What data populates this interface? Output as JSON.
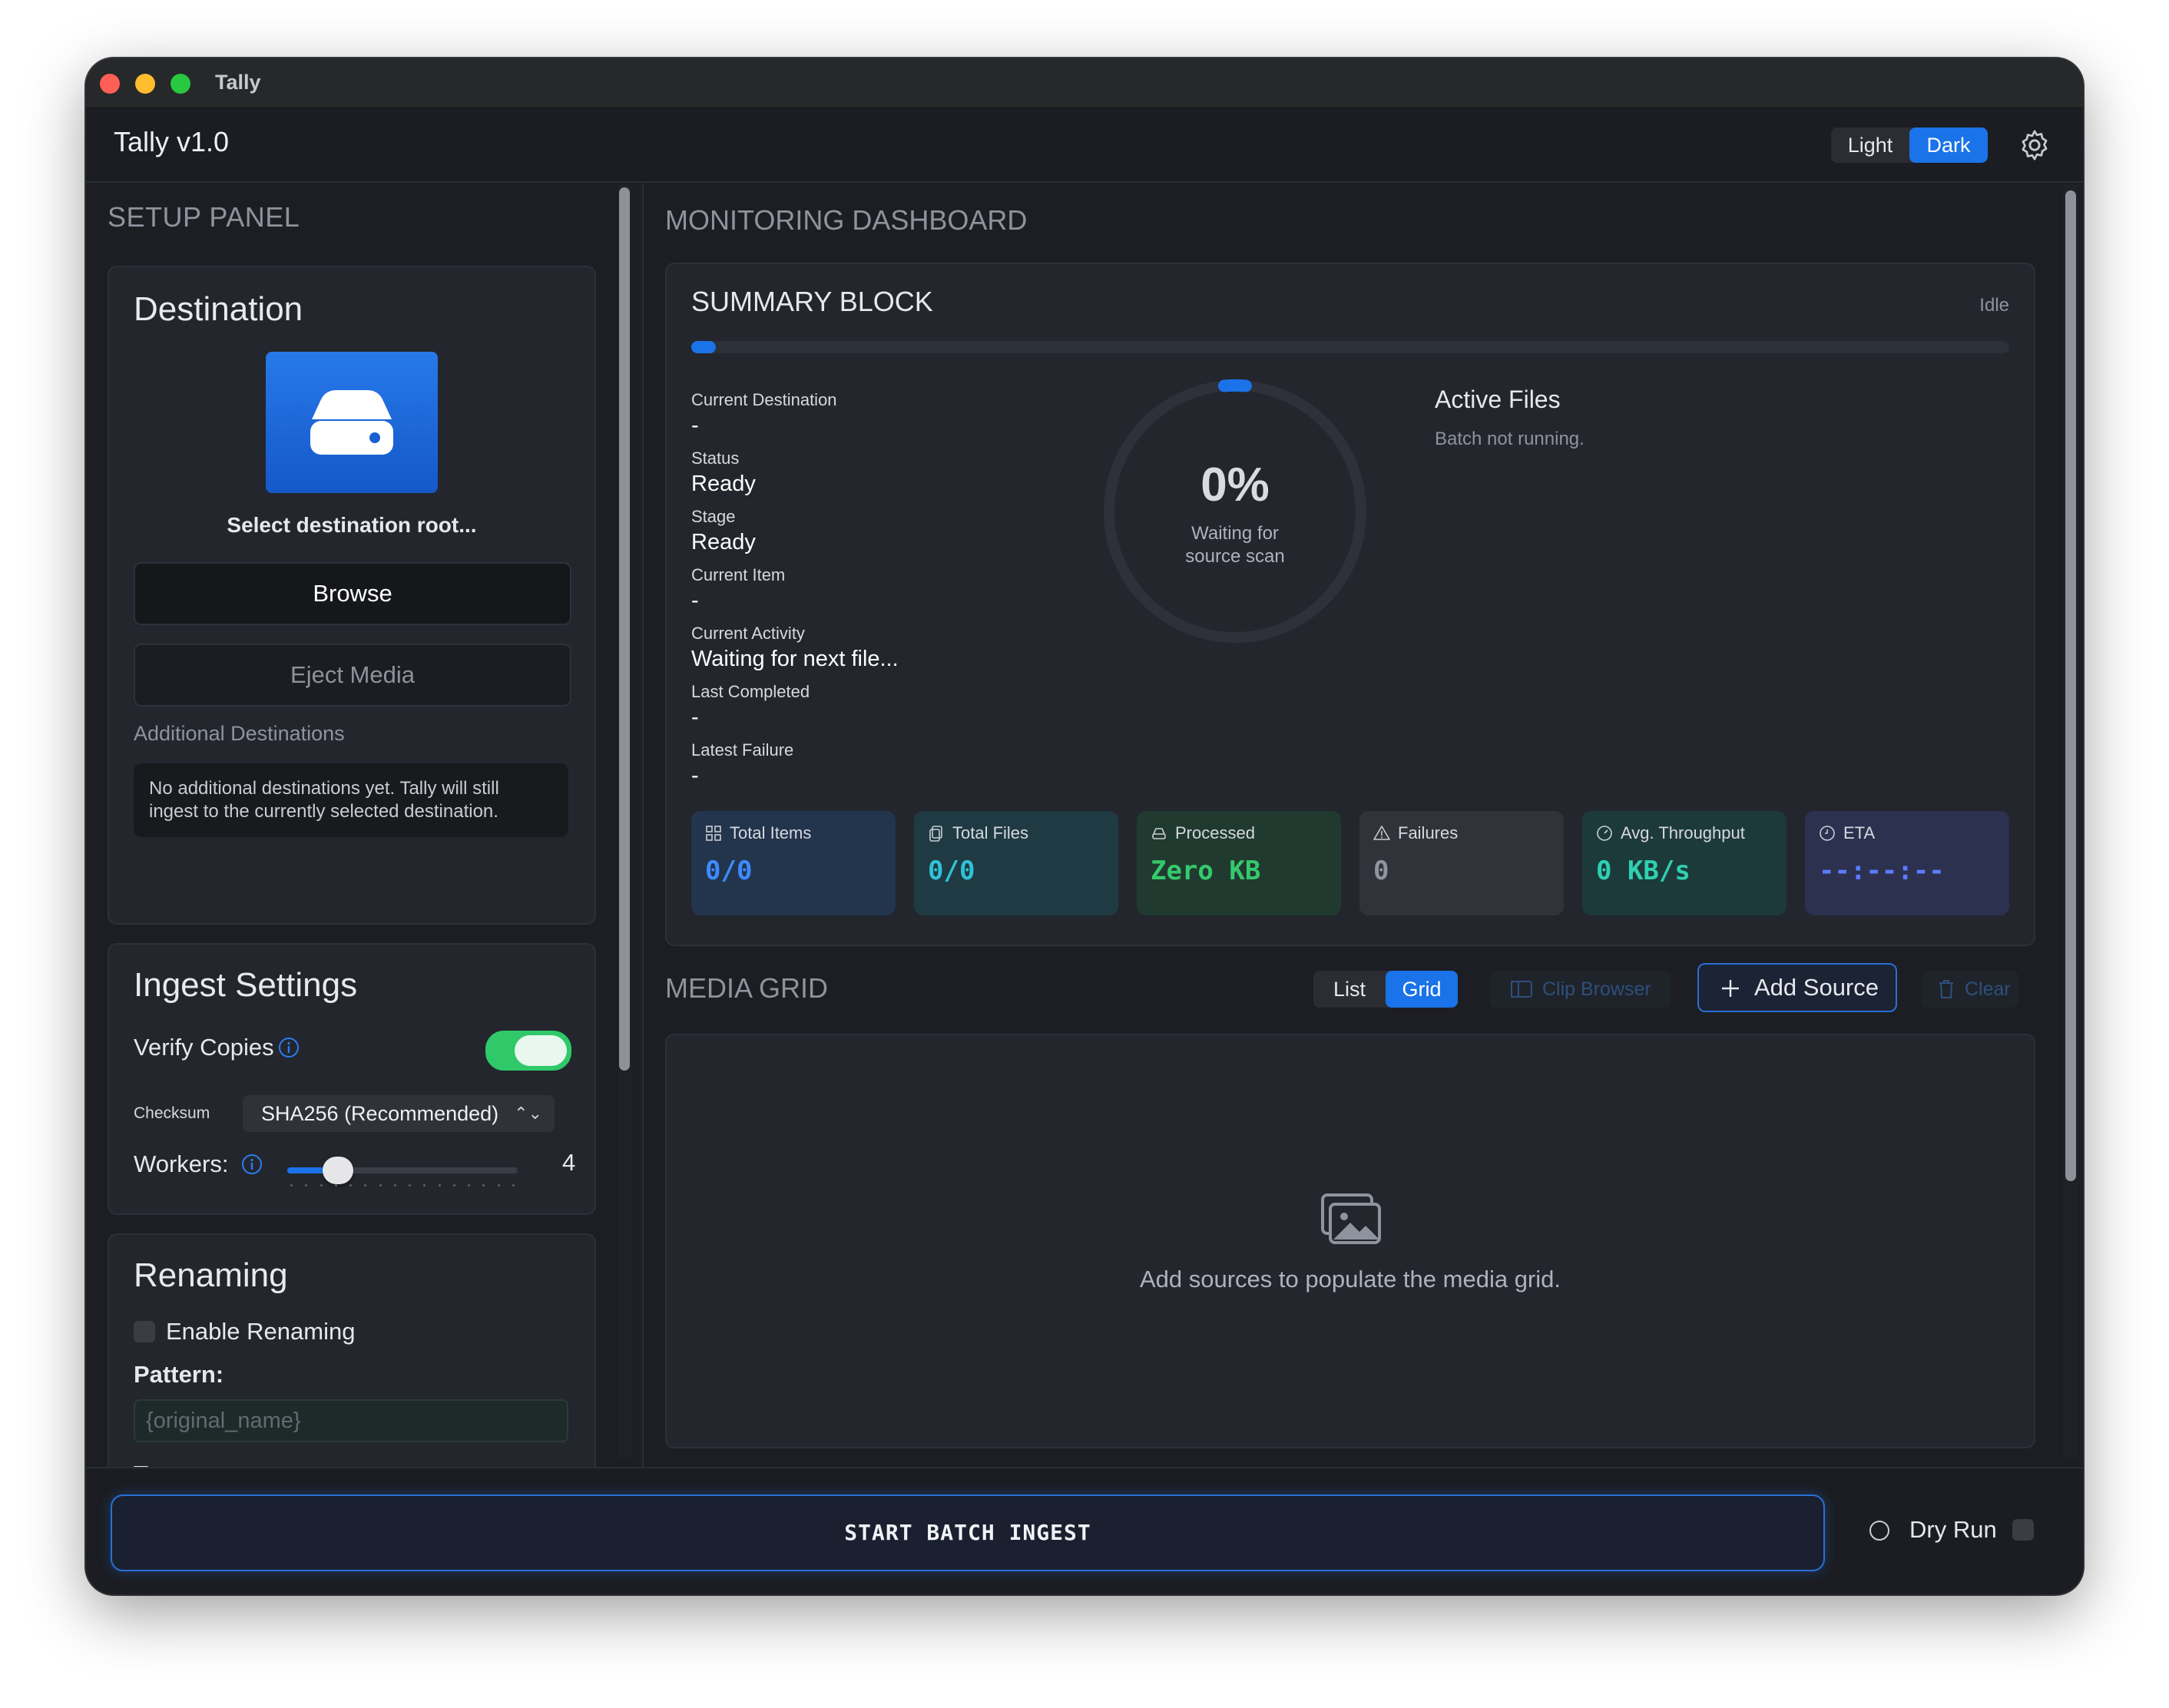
{
  "window": {
    "title": "Tally"
  },
  "header": {
    "app_title": "Tally v1.0",
    "theme_options": [
      "Light",
      "Dark"
    ],
    "theme_selected": "Dark",
    "settings_icon": "gear-icon"
  },
  "setup": {
    "section_title": "SETUP PANEL",
    "destination": {
      "title": "Destination",
      "icon": "drive-icon",
      "select_label": "Select destination root...",
      "browse_label": "Browse",
      "eject_label": "Eject Media",
      "additional_label": "Additional Destinations",
      "additional_note": "No additional destinations yet. Tally will still ingest to the currently selected destination."
    },
    "ingest": {
      "title": "Ingest Settings",
      "verify_label": "Verify Copies",
      "verify_enabled": true,
      "checksum_label": "Checksum",
      "checksum_value": "SHA256 (Recommended)",
      "workers_label": "Workers:",
      "workers_value": "4",
      "workers_fraction": 0.22
    },
    "renaming": {
      "title": "Renaming",
      "enable_label": "Enable Renaming",
      "enabled": false,
      "pattern_label": "Pattern:",
      "pattern_placeholder": "{original_name}",
      "tags_label": "Tags:"
    }
  },
  "dashboard": {
    "section_title": "MONITORING DASHBOARD",
    "summary": {
      "title": "SUMMARY BLOCK",
      "state": "Idle",
      "progress": 0,
      "fields": [
        {
          "k": "Current Destination",
          "v": "-"
        },
        {
          "k": "Status",
          "v": "Ready"
        },
        {
          "k": "Stage",
          "v": "Ready"
        },
        {
          "k": "Current Item",
          "v": "-"
        },
        {
          "k": "Current Activity",
          "v": "Waiting for next file..."
        },
        {
          "k": "Last Completed",
          "v": "-"
        },
        {
          "k": "Latest Failure",
          "v": "-"
        }
      ],
      "ring_percent": "0%",
      "ring_caption": "Waiting for source scan",
      "active_files_title": "Active Files",
      "active_files_note": "Batch not running."
    },
    "stats": [
      {
        "label": "Total Items",
        "value": "0/0",
        "icon": "grid-icon",
        "bg": "#23344d",
        "color": "#3d8bff"
      },
      {
        "label": "Total Files",
        "value": "0/0",
        "icon": "file-copy-icon",
        "bg": "#1f3a42",
        "color": "#2fc1d6"
      },
      {
        "label": "Processed",
        "value": "Zero KB",
        "icon": "drive-icon",
        "bg": "#203a30",
        "color": "#35c96d"
      },
      {
        "label": "Failures",
        "value": "0",
        "icon": "warning-icon",
        "bg": "#30333a",
        "color": "#8f949e"
      },
      {
        "label": "Avg. Throughput",
        "value": "0 KB/s",
        "icon": "speed-icon",
        "bg": "#1d3a3a",
        "color": "#2fd0b0"
      },
      {
        "label": "ETA",
        "value": "--:--:--",
        "icon": "clock-icon",
        "bg": "#2d3150",
        "color": "#5b7cff"
      }
    ],
    "media_grid": {
      "title": "MEDIA GRID",
      "view_options": [
        "List",
        "Grid"
      ],
      "view_selected": "Grid",
      "clip_browser_label": "Clip Browser",
      "add_source_label": "Add Source",
      "clear_label": "Clear",
      "empty_text": "Add sources to populate the media grid."
    }
  },
  "footer": {
    "start_label": "START BATCH INGEST",
    "dry_run_label": "Dry Run",
    "dry_run_enabled": false
  }
}
